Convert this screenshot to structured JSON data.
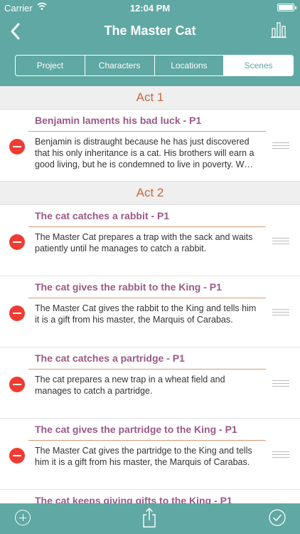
{
  "status": {
    "carrier": "Carrier",
    "time": "12:04 PM"
  },
  "nav": {
    "title": "The Master Cat"
  },
  "segments": [
    "Project",
    "Characters",
    "Locations",
    "Scenes"
  ],
  "acts": [
    {
      "title": "Act 1",
      "scenes": [
        {
          "title": "Benjamin laments his bad luck - P1",
          "description": "Benjamin is distraught because he has just discovered that his only inheritance is a cat. His brothers will earn a good living, but he is condemned to live in poverty. W…"
        }
      ]
    },
    {
      "title": "Act 2",
      "scenes": [
        {
          "title": "The cat catches a rabbit - P1",
          "description": "The Master Cat prepares a trap with the sack and waits patiently until he manages to catch a rabbit."
        },
        {
          "title": "The cat gives the rabbit to the King - P1",
          "description": "The Master Cat gives the rabbit to the King and tells him it is a gift from his master, the Marquis of Carabas."
        },
        {
          "title": "The cat catches a partridge - P1",
          "description": "The cat prepares a new trap in a wheat field and manages to catch a partridge."
        },
        {
          "title": "The cat gives the partridge to the King - P1",
          "description": "The Master Cat gives the partridge to the King and tells him it is a gift from his master, the Marquis of Carabas."
        },
        {
          "title": "The cat keeps giving gifts to the King - P1",
          "description": ""
        }
      ]
    }
  ],
  "icons": {
    "back": "chevron-left-icon",
    "chart": "bar-chart-icon",
    "add": "add-circle-icon",
    "share": "share-icon",
    "done": "checkmark-circle-icon",
    "delete": "delete-circle-icon",
    "reorder": "reorder-handle-icon"
  },
  "colors": {
    "bar": "#5fa8a3",
    "actText": "#c6693b",
    "sceneTitle": "#9a5887",
    "delete": "#f03b32"
  }
}
